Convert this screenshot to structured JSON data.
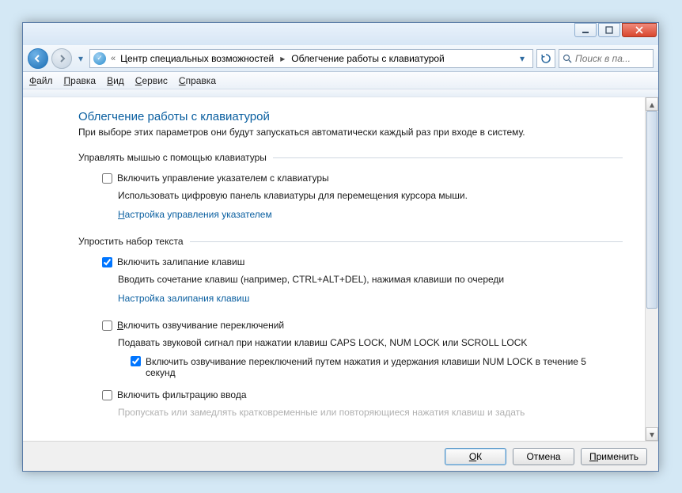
{
  "breadcrumb": {
    "prefix": "«",
    "part1": "Центр специальных возможностей",
    "part2": "Облегчение работы с клавиатурой"
  },
  "search": {
    "placeholder": "Поиск в па..."
  },
  "menu": {
    "file": "айл",
    "edit": "равка",
    "view": "ид",
    "tools": "ервис",
    "help": "правка"
  },
  "page": {
    "title": "Облегчение работы с клавиатурой",
    "desc": "При выборе этих параметров они будут запускаться автоматически каждый раз при входе в систему."
  },
  "sec1": {
    "header": "Управлять мышью с помощью клавиатуры",
    "opt1": "Включить управление указателем с клавиатуры",
    "desc1": "Использовать цифровую панель клавиатуры для перемещения курсора мыши.",
    "link1": "астройка управления указателем"
  },
  "sec2": {
    "header": "Упростить набор текста",
    "opt1": "Включить залипание клавиш",
    "desc1": "Вводить сочетание клавиш (например, CTRL+ALT+DEL), нажимая клавиши по очереди",
    "link1": "Настройка залипания клавиш",
    "opt2": "ключить озвучивание переключений",
    "desc2": "Подавать звуковой сигнал при нажатии клавиш CAPS LOCK, NUM LOCK или SCROLL LOCK",
    "sub1": "ключить озвучивание переключений путем нажатия и удержания клавиши NUM LOCK в течение 5 секунд",
    "opt3": "Включить фильтрацию ввода",
    "desc3_partial": "Пропускать или замедлять кратковременные или повторяющиеся нажатия клавиш и задать"
  },
  "buttons": {
    "ok": "К",
    "cancel": "Отмена",
    "apply": "рименить"
  }
}
